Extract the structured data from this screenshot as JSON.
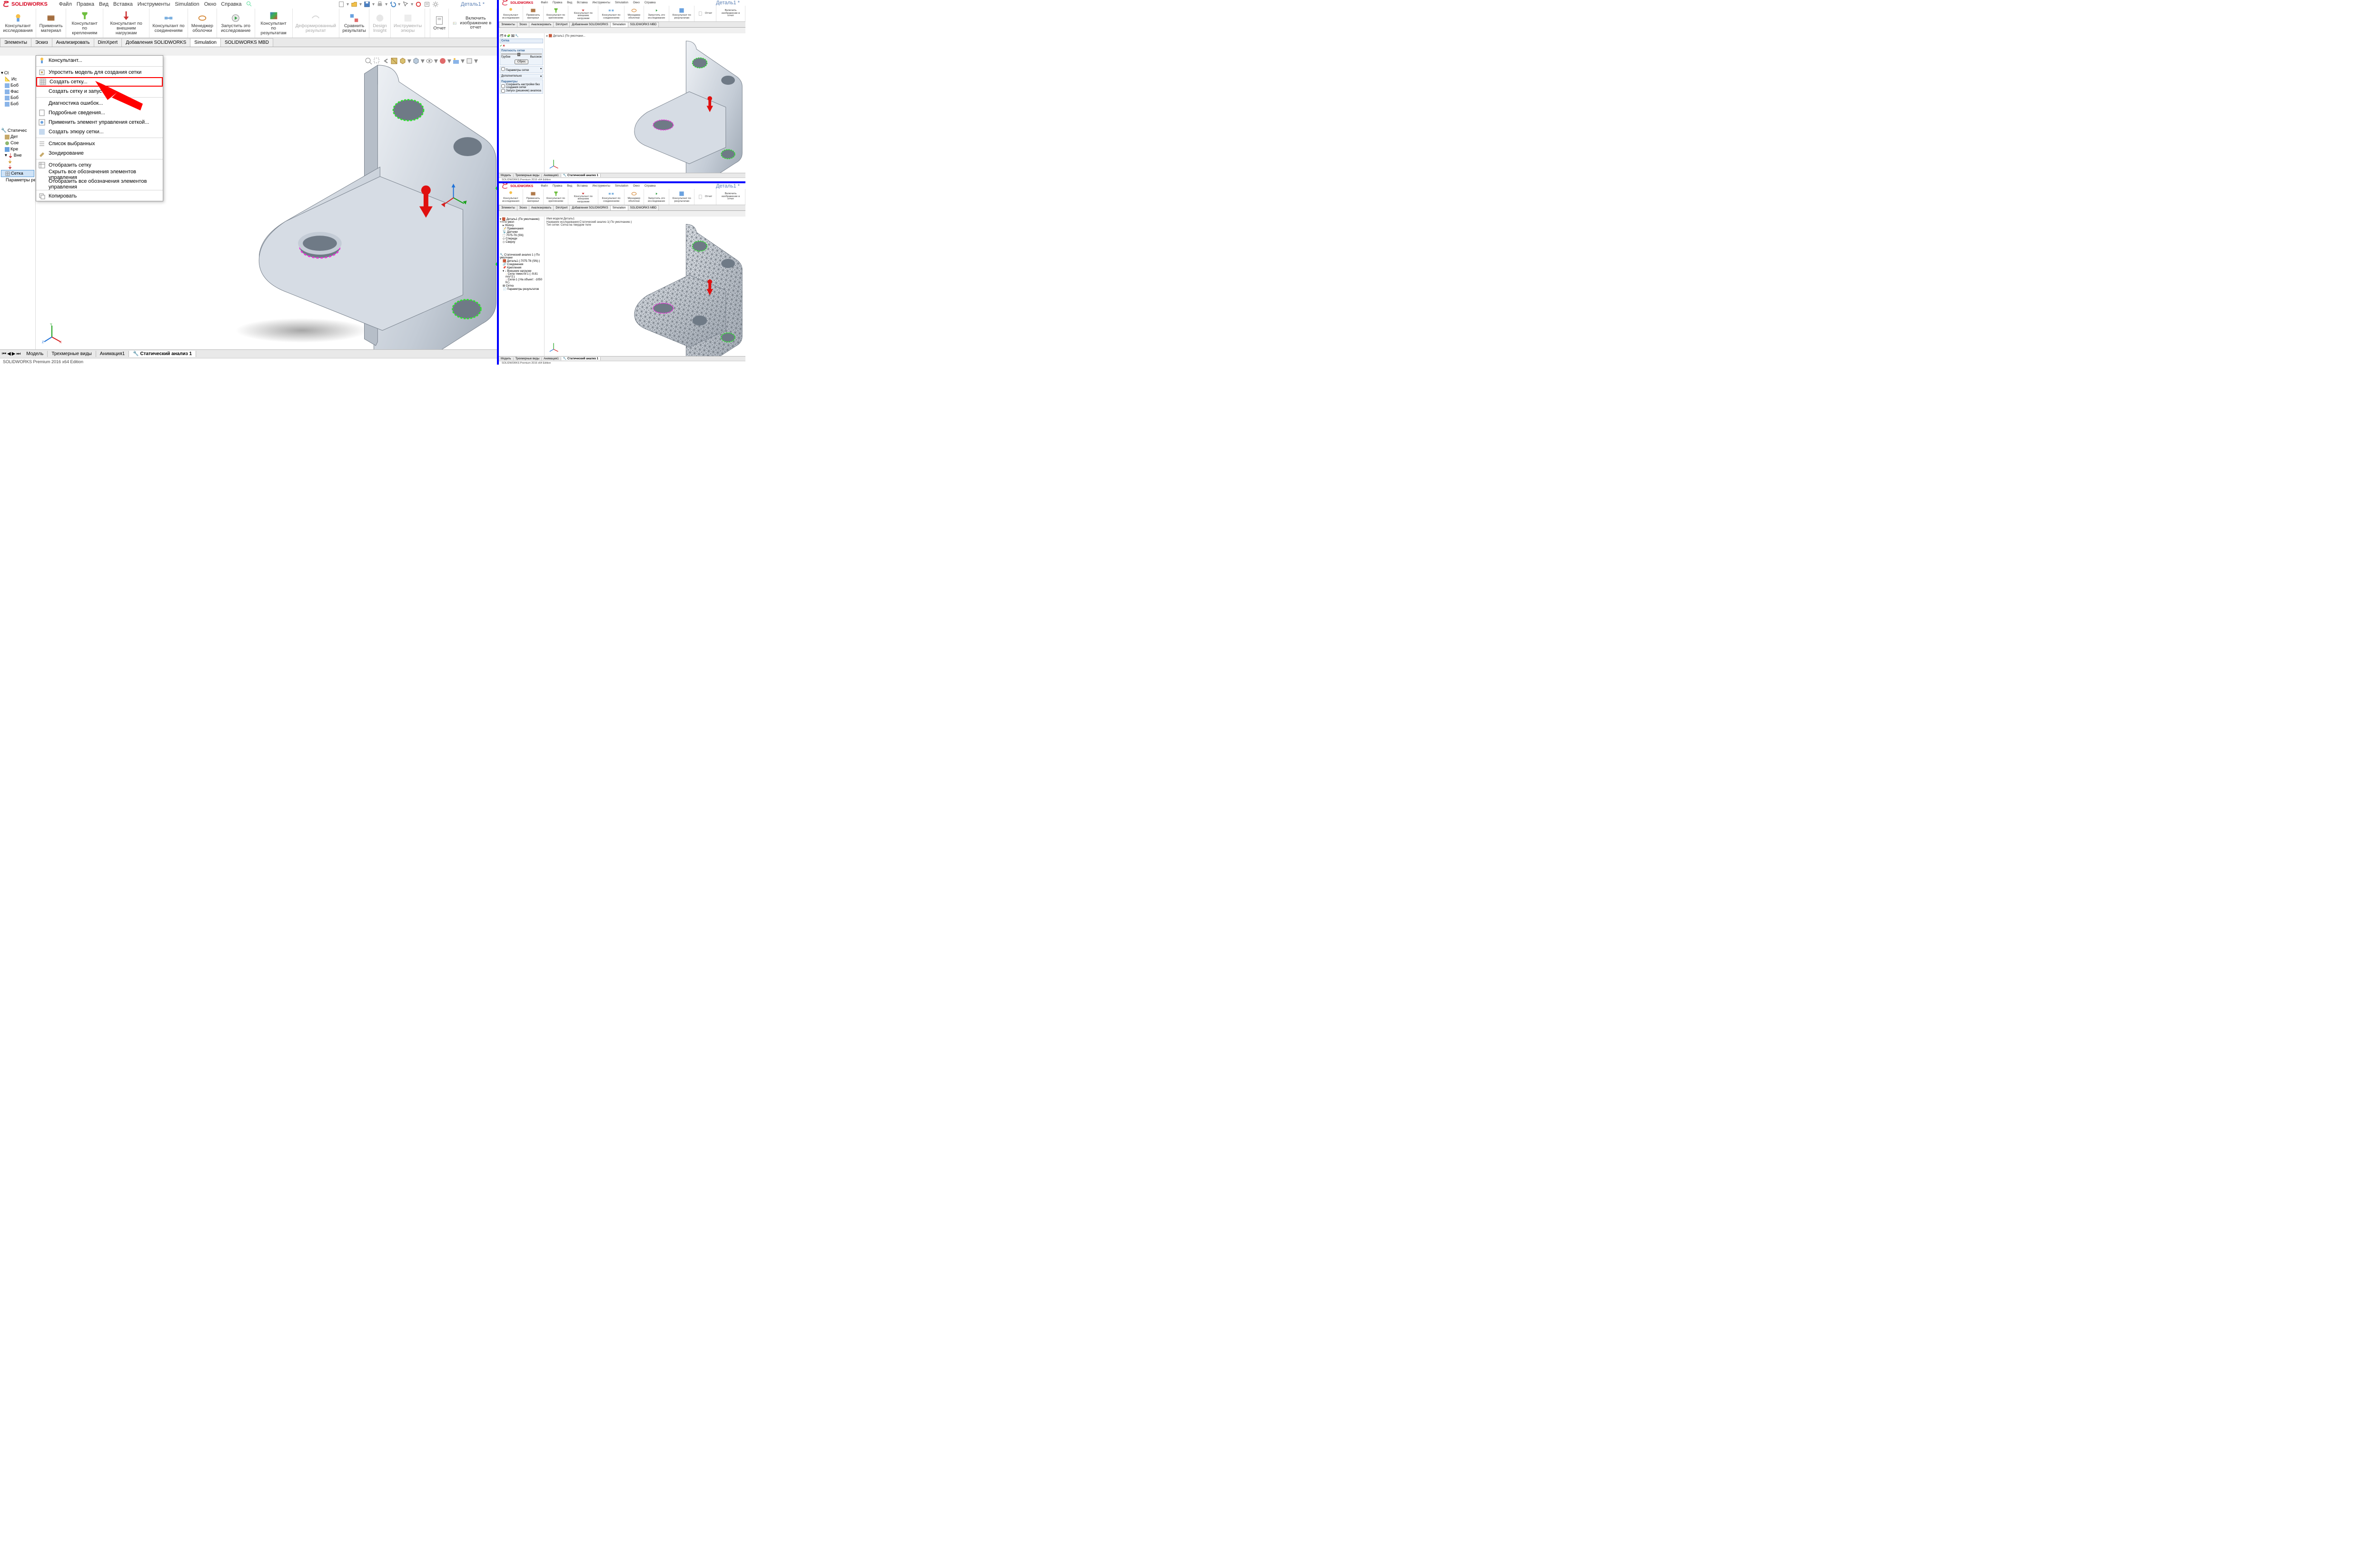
{
  "brand": "SOLIDWORKS",
  "doc_title": "Деталь1 *",
  "menus": [
    "Файл",
    "Правка",
    "Вид",
    "Вставка",
    "Инструменты",
    "Simulation",
    "Окно",
    "Справка"
  ],
  "ribbon": {
    "g1": "Консультант исследования",
    "g2": "Применить материал",
    "g3": "Консультант по креплениям",
    "g4": "Консультант по внешним нагрузкам",
    "g5": "Консультант по соединениям",
    "g6": "Менеджер оболочки",
    "g7": "Запустить это исследование",
    "g8": "Консультант по результатам",
    "g9": "Деформированный результат",
    "g10": "Сравнить результаты",
    "g11": "Design Insight",
    "g12": "Инструменты эпюры",
    "g13": "Отчет",
    "g14": "Включить изображение в отчет"
  },
  "tabs": [
    "Элементы",
    "Эскиз",
    "Анализировать",
    "DimXpert",
    "Добавления SOLIDWORKS",
    "Simulation",
    "SOLIDWORKS MBD"
  ],
  "active_tab": "Simulation",
  "tree": {
    "part_name": "Деталь1 (По умол",
    "items": [
      "Ct",
      "Ис",
      "Боб",
      "Фаc",
      "Боб",
      "Боб"
    ],
    "study": "Статичес",
    "study_items": [
      "Дет",
      "Сoe",
      "Кре",
      "Вне"
    ],
    "mesh": "Сетка",
    "results": "Параметры результатов"
  },
  "context_menu": {
    "items": [
      "Консультант...",
      "Упростить модель для создания сетки",
      "Создать сетку...",
      "Создать сетку и запустить",
      "Диагностика ошибок...",
      "Подробные сведения...",
      "Применить элемент управления сеткой...",
      "Создать эпюру сетки...",
      "Список выбранных",
      "Зондирование",
      "Отобразить сетку",
      "Скрыть все обозначения элементов управления",
      "Отобразить все обозначения элементов управления",
      "Копировать"
    ]
  },
  "bottom_tabs": [
    "Модель",
    "Трехмерные виды",
    "Анимация1",
    "Статический анализ 1"
  ],
  "status": "SOLIDWORKS Premium 2016 x64 Edition",
  "side_top": {
    "pm_title": "Сетка",
    "density_hdr": "Плотность сетки",
    "coarse": "Грубое",
    "fine": "Высокое",
    "reset": "Сброс",
    "p_hdr": "Параметры сетки",
    "adv_hdr": "Дополнительно",
    "opt_hdr": "Параметры",
    "opt1": "Сохранить настройки без создания сетки",
    "opt2": "Запуск (решение) анализа",
    "breadcrumb": "Деталь1 (По умолчани..."
  },
  "side_bot": {
    "msg1": "Имя модели:Деталь1",
    "msg2": "Название исследования:Статический анализ 1(-По умолчанию-)",
    "msg3": "Тип сетки: Сетка на твердом теле",
    "tree_root": "Деталь1 (По умолчанию) <<По умол",
    "hist": "History",
    "annot": "Примечания",
    "sens": "Датчики",
    "mat": "7075-T6 (SN)",
    "front": "Спереди",
    "top": "Сверху",
    "study": "Статический анализ 1 (-По умолчани",
    "part": "Деталь1 (-7075-T6 (SN)-)",
    "conn": "Соединения",
    "fix": "Крепления",
    "loads": "Внешние нагрузки",
    "grav": "Сила тяжести-1 (:-9.81 m/s^2:)",
    "force": "Сила-1 (:На объект: -1050 N:)",
    "mesh": "Сетка",
    "res": "Параметры результатов"
  }
}
